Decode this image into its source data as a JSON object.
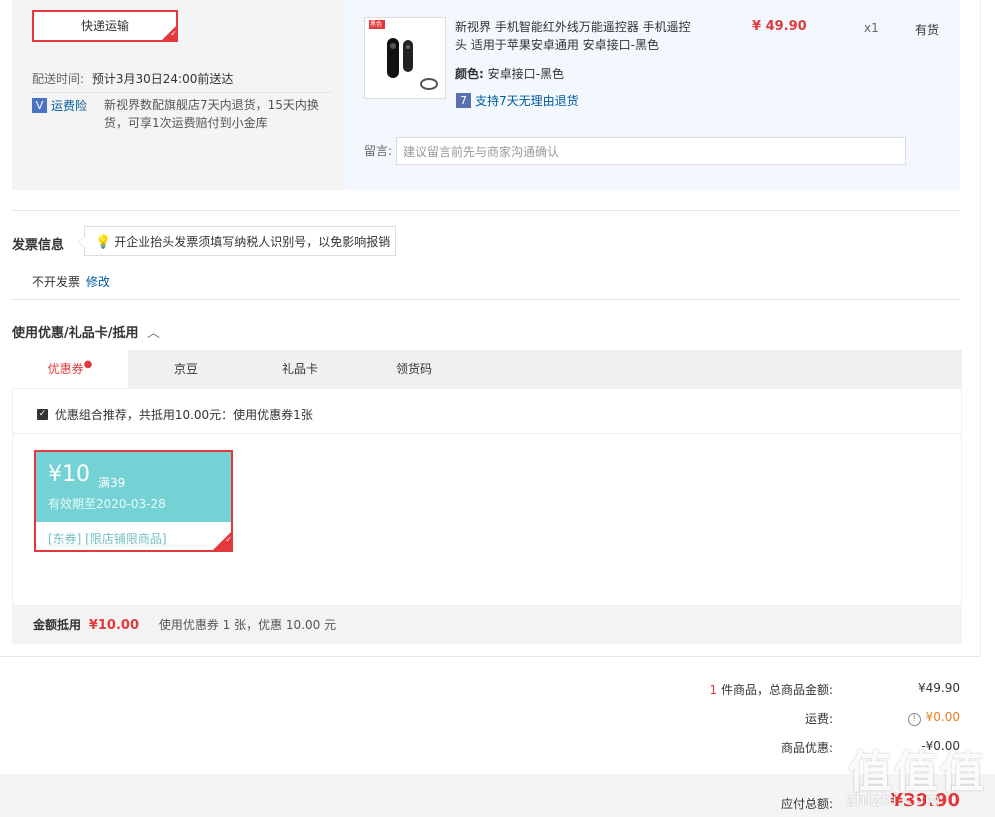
{
  "shipping": {
    "express_label": "快递运输",
    "delivery_label": "配送时间:",
    "delivery_value": "预计3月30日24:00前送达",
    "insurance_badge": "V",
    "insurance_label": "运费险",
    "insurance_desc_line1": "新视界数配旗舰店7天内退货，15天内换",
    "insurance_desc_line2": "货，可享1次运费赔付到小金库"
  },
  "product": {
    "thumb_tag": "黑色",
    "title_line1": "新视界 手机智能红外线万能遥控器 手机遥控",
    "title_line2": "头 适用于苹果安卓通用 安卓接口-黑色",
    "price": "¥ 49.90",
    "qty": "x1",
    "stock": "有货",
    "attr_label": "颜色:",
    "attr_value": "安卓接口-黑色",
    "return_badge": "7",
    "return_text": "支持7天无理由退货",
    "message_label": "留言:",
    "message_placeholder": "建议留言前先与商家沟通确认"
  },
  "invoice": {
    "title": "发票信息",
    "tip": "开企业抬头发票须填写纳税人识别号，以免影响报销",
    "status": "不开发票",
    "edit": "修改"
  },
  "discount": {
    "title": "使用优惠/礼品卡/抵用",
    "tabs": [
      "优惠券",
      "京豆",
      "礼品卡",
      "领货码"
    ],
    "recommend_text": "优惠组合推荐，共抵用10.00元：使用优惠券1张",
    "coupon": {
      "amount": "¥10",
      "condition": "满39",
      "expiry": "有效期至2020-03-28",
      "tags": "[东券]  [限店铺限商品]"
    },
    "summary_label": "金额抵用",
    "summary_amount": "¥10.00",
    "summary_desc": "使用优惠券 1 张，优惠 10.00 元"
  },
  "totals": {
    "count": "1",
    "count_suffix": "件商品，总商品金额:",
    "goods_total": "¥49.90",
    "shipping_label": "运费:",
    "shipping_value": "¥0.00",
    "discount_label": "商品优惠:",
    "discount_value": "-¥0.00",
    "payable_label": "应付总额:",
    "payable_value": "¥39.90"
  },
  "watermark": {
    "main": "值值值",
    "sub": "zhizhi.com"
  },
  "colors": {
    "accent": "#e4393c",
    "coupon_teal": "#74d2d4",
    "link": "#005aa0"
  }
}
